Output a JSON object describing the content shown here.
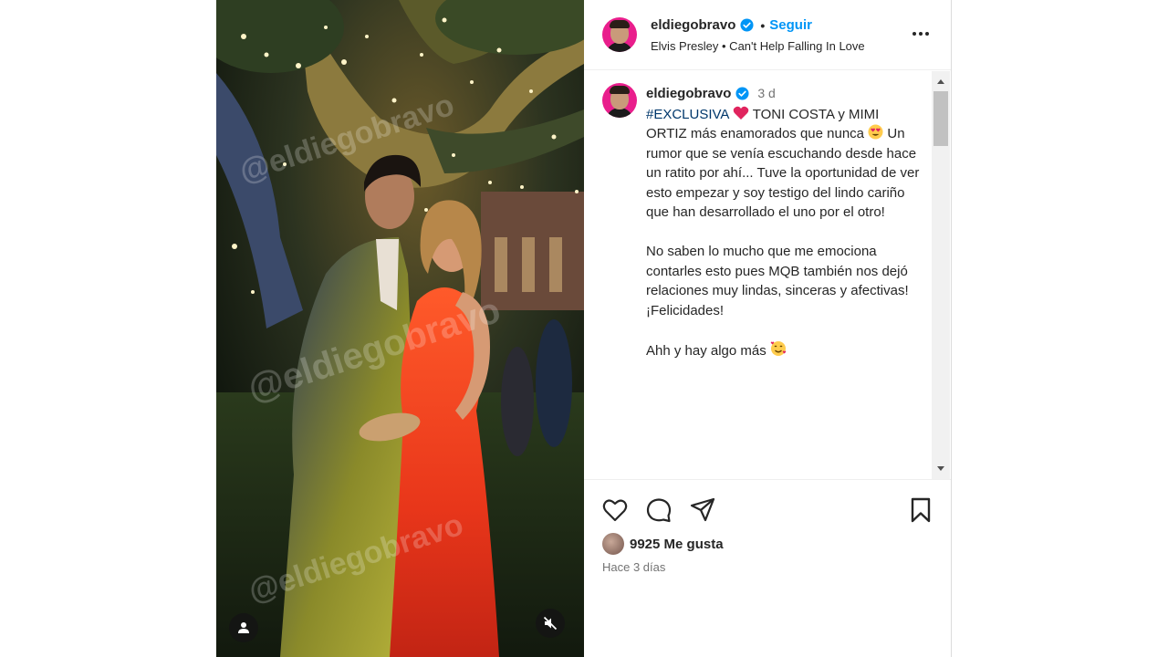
{
  "header": {
    "username": "eldiegobravo",
    "separator": "•",
    "follow_label": "Seguir",
    "song": "Elvis Presley • Can't Help Falling In Love"
  },
  "caption": {
    "username": "eldiegobravo",
    "time": "3 d",
    "hashtag": "#EXCLUSIVA",
    "line1_rest": "TONI COSTA y MIMI ORTIZ más enamorados que nunca",
    "line1_tail": "Un rumor que se venía escuchando desde hace un ratito por ahí... Tuve la oportunidad de ver esto empezar y soy testigo del lindo cariño que han desarrollado el uno por el otro!",
    "paragraph2": "No saben lo mucho que me emociona contarles esto pues MQB también nos dejó relaciones muy lindas, sinceras y afectivas! ¡Felicidades!",
    "paragraph3": "Ahh y hay algo más"
  },
  "engagement": {
    "likes": "9925 Me gusta",
    "date": "Hace 3 días"
  },
  "media": {
    "watermark": "@eldiegobravo"
  },
  "colors": {
    "accent_blue": "#0095f6",
    "verified_blue": "#0095f6",
    "hashtag": "#00376b",
    "avatar_ring": "#e91e8c",
    "secondary_text": "#737373"
  },
  "icons": {
    "like": "heart-outline-icon",
    "comment": "speech-bubble-icon",
    "share": "paper-plane-icon",
    "save": "bookmark-icon",
    "more": "ellipsis-icon",
    "verified": "verified-badge-icon",
    "user": "user-tag-icon",
    "mute": "speaker-muted-icon"
  }
}
